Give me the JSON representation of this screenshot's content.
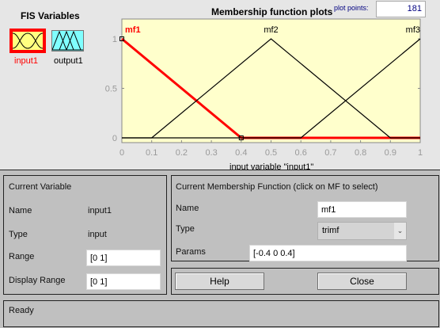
{
  "fis_variables": {
    "title": "FIS Variables",
    "items": [
      {
        "label": "input1",
        "selected": true,
        "color": "#ffff80"
      },
      {
        "label": "output1",
        "selected": false,
        "color": "#80ffff"
      }
    ]
  },
  "plot": {
    "title": "Membership function plots",
    "plot_points_label": "plot points:",
    "plot_points_value": "181",
    "xlabel": "input variable \"input1\"",
    "chart_data": {
      "type": "line",
      "xlim": [
        0,
        1
      ],
      "ylim": [
        0,
        1
      ],
      "xticks": [
        "0",
        "0.1",
        "0.2",
        "0.3",
        "0.4",
        "0.5",
        "0.6",
        "0.7",
        "0.8",
        "0.9",
        "1"
      ],
      "yticks": [
        "0",
        "0.5",
        "1"
      ],
      "series": [
        {
          "name": "mf1",
          "params": [
            -0.4,
            0,
            0.4
          ],
          "selected": true,
          "color": "#ff0000"
        },
        {
          "name": "mf2",
          "params": [
            0.1,
            0.5,
            0.9
          ],
          "selected": false,
          "color": "#000000"
        },
        {
          "name": "mf3",
          "params": [
            0.6,
            1,
            1.4
          ],
          "selected": false,
          "color": "#000000"
        }
      ]
    }
  },
  "current_variable": {
    "title": "Current Variable",
    "name_label": "Name",
    "name_value": "input1",
    "type_label": "Type",
    "type_value": "input",
    "range_label": "Range",
    "range_value": "[0 1]",
    "display_range_label": "Display Range",
    "display_range_value": "[0 1]"
  },
  "current_mf": {
    "title": "Current Membership Function (click on MF to select)",
    "name_label": "Name",
    "name_value": "mf1",
    "type_label": "Type",
    "type_value": "trimf",
    "params_label": "Params",
    "params_value": "[-0.4 0 0.4]"
  },
  "buttons": {
    "help": "Help",
    "close": "Close"
  },
  "status": "Ready"
}
